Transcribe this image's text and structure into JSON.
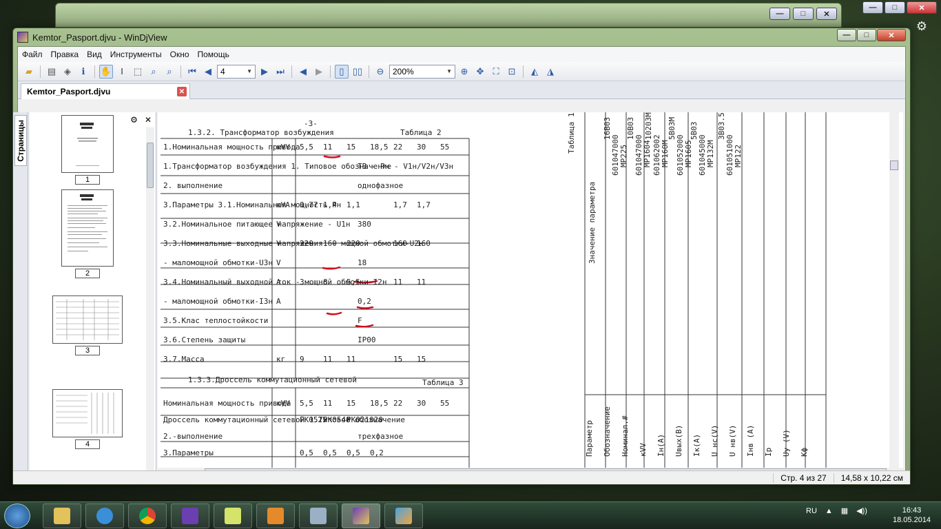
{
  "window": {
    "title": "Kemtor_Pasport.djvu - WinDjView"
  },
  "menu": [
    "Файл",
    "Правка",
    "Вид",
    "Инструменты",
    "Окно",
    "Помощь"
  ],
  "toolbar": {
    "page_value": "4",
    "zoom_value": "200%"
  },
  "tab": {
    "label": "Kemtor_Pasport.djvu"
  },
  "sidebar": {
    "tab_label": "Страницы",
    "thumbnails": [
      "1",
      "2",
      "3",
      "4"
    ]
  },
  "document": {
    "page_mark": "-3-",
    "heading": "1.3.2. Трансформатор возбуждения",
    "table_label": "Таблица 2",
    "table2_rows": [
      {
        "label": "1.Номинальная мощность привода",
        "unit": "кVV",
        "values": [
          "5,5",
          "11",
          "15",
          "18,5",
          "22",
          "30",
          "55"
        ]
      },
      {
        "label": "1.Трансформатор возбуждения 1. Типовое обозначение",
        "unit": "",
        "values": [
          "ТВ - Рн - V1н/V2н/V3н"
        ]
      },
      {
        "label": "2. выполнение",
        "unit": "",
        "values": [
          "однофазное"
        ]
      },
      {
        "label": "3.Параметры 3.1.Номинальная мощность Рн",
        "unit": "кVA",
        "values": [
          "0,77",
          "1,4",
          "1,1",
          "",
          "1,7",
          "1,7"
        ]
      },
      {
        "label": "3.2.Номинальное питающее напряжение - U1н",
        "unit": "V",
        "values": [
          "380"
        ]
      },
      {
        "label": "3.3.Номинальные выходные напряжения: - мощной обмотки-U2н",
        "unit": "V",
        "values": [
          "220",
          "160",
          "220",
          "",
          "160",
          "160"
        ]
      },
      {
        "label": "- маломощной обмотки-U3н",
        "unit": "V",
        "values": [
          "18"
        ]
      },
      {
        "label": "3.4.Номинальный выходной ток - мощной обмотки-I2н",
        "unit": "A",
        "values": [
          "3",
          "8",
          "5,5",
          "",
          "11",
          "11"
        ]
      },
      {
        "label": "- маломощной обмотки-I3н",
        "unit": "A",
        "values": [
          "0,2"
        ]
      },
      {
        "label": "3.5.Клас теплостойкости",
        "unit": "",
        "values": [
          "F"
        ]
      },
      {
        "label": "3.6.Степень защиты",
        "unit": "",
        "values": [
          "IP00"
        ]
      },
      {
        "label": "3.7.Масса",
        "unit": "кг",
        "values": [
          "9",
          "11",
          "11",
          "",
          "15",
          "15"
        ]
      }
    ],
    "heading2": "1.3.3.Дроссель коммутационный сетевой",
    "table_label2": "Таблица 3",
    "table3_rows": [
      {
        "label": "Номинальная мощность привода",
        "unit": "кVV",
        "values": [
          "5,5",
          "11",
          "15",
          "18,5",
          "22",
          "30",
          "55"
        ]
      },
      {
        "label": "Дроссель коммутационный сетевой 1.Типовое обозначение",
        "unit": "",
        "values": [
          "РК0525",
          "РК0548",
          "РК021020"
        ]
      },
      {
        "label": "2.-выполнение",
        "unit": "",
        "values": [
          "трехфазное"
        ]
      },
      {
        "label": "3.Параметры",
        "unit": "",
        "values": [
          "0,5",
          "0,5",
          "0,5",
          "0,2"
        ]
      }
    ],
    "rotated_title": "Таблица 1",
    "rotated_header": "Значение параметра",
    "rotated_cols": [
      "16В03",
      "10В03",
      "10203М",
      "5В03М",
      "5В03",
      "3В03.5"
    ],
    "rotated_codes": [
      "601047000",
      "601047000",
      "601062002",
      "601052000",
      "601045000",
      "601051000"
    ],
    "rotated_models": [
      "МР225",
      "МР1604",
      "МР160М",
      "МР1605",
      "МР132М",
      "МР122"
    ],
    "rotated_param_labels": [
      "Параметр",
      "Обозначение",
      "Номинал.#",
      "кVV",
      "Iн(А)",
      "Uвых(В)",
      "Iк(А)",
      "U нс(V)",
      "U нв(V)",
      "Iнв (А)",
      "Iр",
      "Uу (V)",
      "Кф"
    ]
  },
  "status": {
    "page_info": "Стр. 4 из 27",
    "page_size": "14,58 x 10,22 см"
  },
  "taskbar": {
    "lang": "RU",
    "time": "16:43",
    "date": "18.05.2014"
  },
  "colors": {
    "annotation": "#d01020",
    "titlebar": "#a7c08f"
  }
}
